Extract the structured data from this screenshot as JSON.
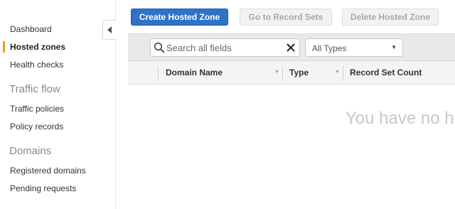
{
  "sidebar": {
    "items": [
      {
        "label": "Dashboard"
      },
      {
        "label": "Hosted zones",
        "active": true
      },
      {
        "label": "Health checks"
      }
    ],
    "sections": [
      {
        "heading": "Traffic flow",
        "items": [
          {
            "label": "Traffic policies"
          },
          {
            "label": "Policy records"
          }
        ]
      },
      {
        "heading": "Domains",
        "items": [
          {
            "label": "Registered domains"
          },
          {
            "label": "Pending requests"
          }
        ]
      }
    ],
    "collapse_icon": "chevron-left-icon"
  },
  "toolbar": {
    "create_label": "Create Hosted Zone",
    "goto_label": "Go to Record Sets",
    "delete_label": "Delete Hosted Zone"
  },
  "filter": {
    "search_placeholder": "Search all fields",
    "search_value": "",
    "type_selected": "All Types"
  },
  "table": {
    "columns": [
      {
        "label": "Domain Name"
      },
      {
        "label": "Type"
      },
      {
        "label": "Record Set Count"
      }
    ],
    "empty_message": "You have no h"
  },
  "colors": {
    "primary": "#2f73c9",
    "active_accent": "#f29a1a"
  }
}
